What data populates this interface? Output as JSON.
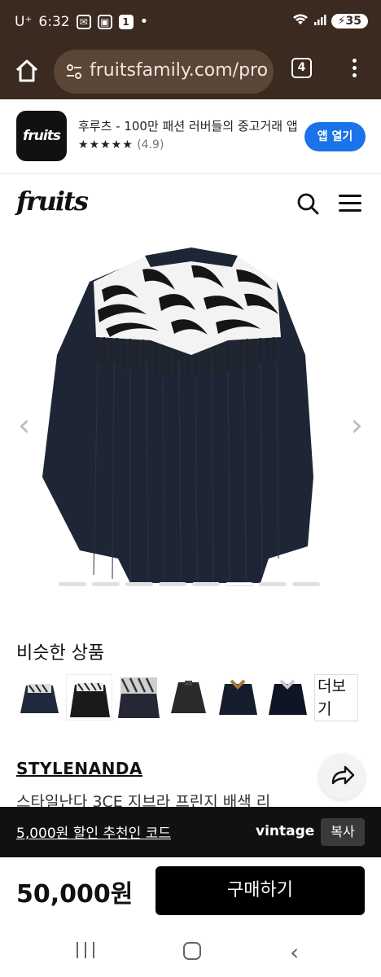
{
  "status_bar": {
    "carrier": "U⁺",
    "time": "6:32",
    "notif_count": "1",
    "battery": "35"
  },
  "browser": {
    "url": "fruitsfamily.com/pro",
    "tab_count": "4"
  },
  "app_banner": {
    "icon_text": "fruits",
    "title": "후루츠 - 100만 패션 러버들의 중고거래 앱",
    "stars": "★★★★★",
    "rating": "(4.9)",
    "open_button": "앱 열기"
  },
  "site": {
    "logo": "fruits"
  },
  "product": {
    "similar_title": "비슷한 상품",
    "more_label": "더보기",
    "brand": "STYLENANDA",
    "title": "스타일난다 3CE 지브라 프린지 배색 리",
    "price": "50,000원",
    "buy_button": "구매하기"
  },
  "referral": {
    "text": "5,000원 할인 추천인 코드",
    "code": "vintage",
    "copy_button": "복사"
  },
  "carousel": {
    "total": 8,
    "active_index": 5
  },
  "colors": {
    "browser_bar": "#3a2a1f",
    "accent_blue": "#1a73e8"
  }
}
